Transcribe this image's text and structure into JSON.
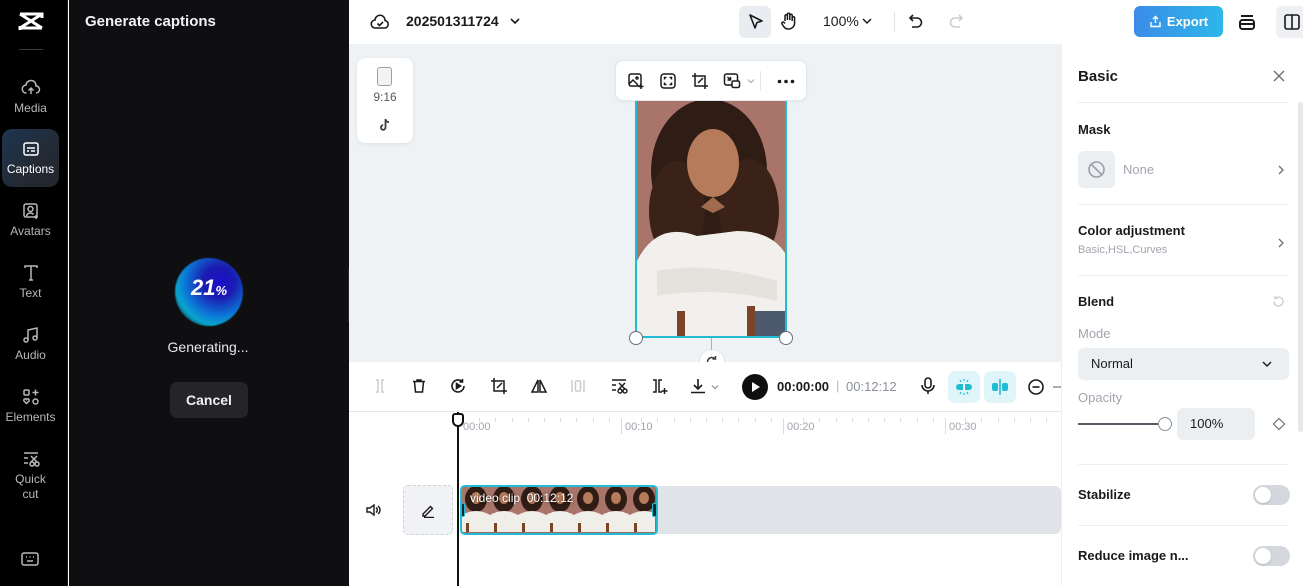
{
  "nav": {
    "items": [
      {
        "label": "Media",
        "icon": "cloud-upload-icon"
      },
      {
        "label": "Captions",
        "icon": "captions-icon",
        "active": true
      },
      {
        "label": "Avatars",
        "icon": "avatar-icon"
      },
      {
        "label": "Text",
        "icon": "text-icon"
      },
      {
        "label": "Audio",
        "icon": "music-note-icon"
      },
      {
        "label": "Elements",
        "icon": "elements-icon"
      },
      {
        "label": "Quick cut",
        "icon": "quick-cut-icon"
      }
    ]
  },
  "panel": {
    "title": "Generate captions",
    "progress_value": "21",
    "progress_unit": "%",
    "status": "Generating...",
    "cancel_label": "Cancel"
  },
  "topbar": {
    "project_name": "202501311724",
    "zoom": "100%",
    "export_label": "Export"
  },
  "canvas": {
    "aspect_ratio": "9:16",
    "platform_icon": "tiktok-icon"
  },
  "transport": {
    "current_time": "00:00:00",
    "separator": "|",
    "total_time": "00:12:12"
  },
  "timeline": {
    "ruler": [
      "00:00",
      "00:10",
      "00:20",
      "00:30"
    ],
    "clip": {
      "label": "video clip",
      "duration": "00:12:12"
    }
  },
  "props": {
    "title": "Basic",
    "mask": {
      "label": "Mask",
      "value": "None"
    },
    "color_adjustment": {
      "label": "Color adjustment",
      "sub": "Basic,HSL,Curves"
    },
    "blend": {
      "label": "Blend",
      "mode_label": "Mode",
      "mode_value": "Normal",
      "opacity_label": "Opacity",
      "opacity_value": "100%"
    },
    "stabilize": {
      "label": "Stabilize",
      "on": false
    },
    "reduce_noise": {
      "label": "Reduce image n...",
      "on": false
    }
  },
  "colors": {
    "accent": "#1fbcd3",
    "export_start": "#3b8ce8",
    "export_end": "#2db7e8"
  }
}
